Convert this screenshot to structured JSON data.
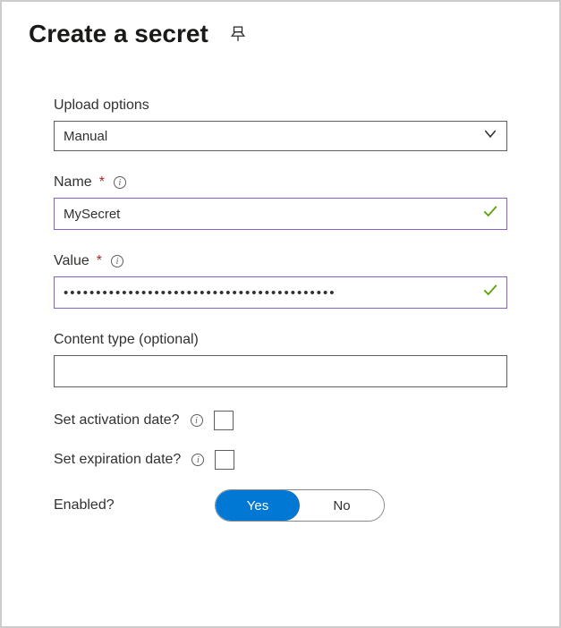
{
  "header": {
    "title": "Create a secret"
  },
  "form": {
    "upload_options": {
      "label": "Upload options",
      "value": "Manual"
    },
    "name": {
      "label": "Name",
      "value": "MySecret",
      "required": "*"
    },
    "value": {
      "label": "Value",
      "value": "••••••••••••••••••••••••••••••••••••••••••",
      "required": "*"
    },
    "content_type": {
      "label": "Content type (optional)",
      "value": ""
    },
    "activation": {
      "label": "Set activation date?"
    },
    "expiration": {
      "label": "Set expiration date?"
    },
    "enabled": {
      "label": "Enabled?",
      "yes": "Yes",
      "no": "No"
    }
  }
}
